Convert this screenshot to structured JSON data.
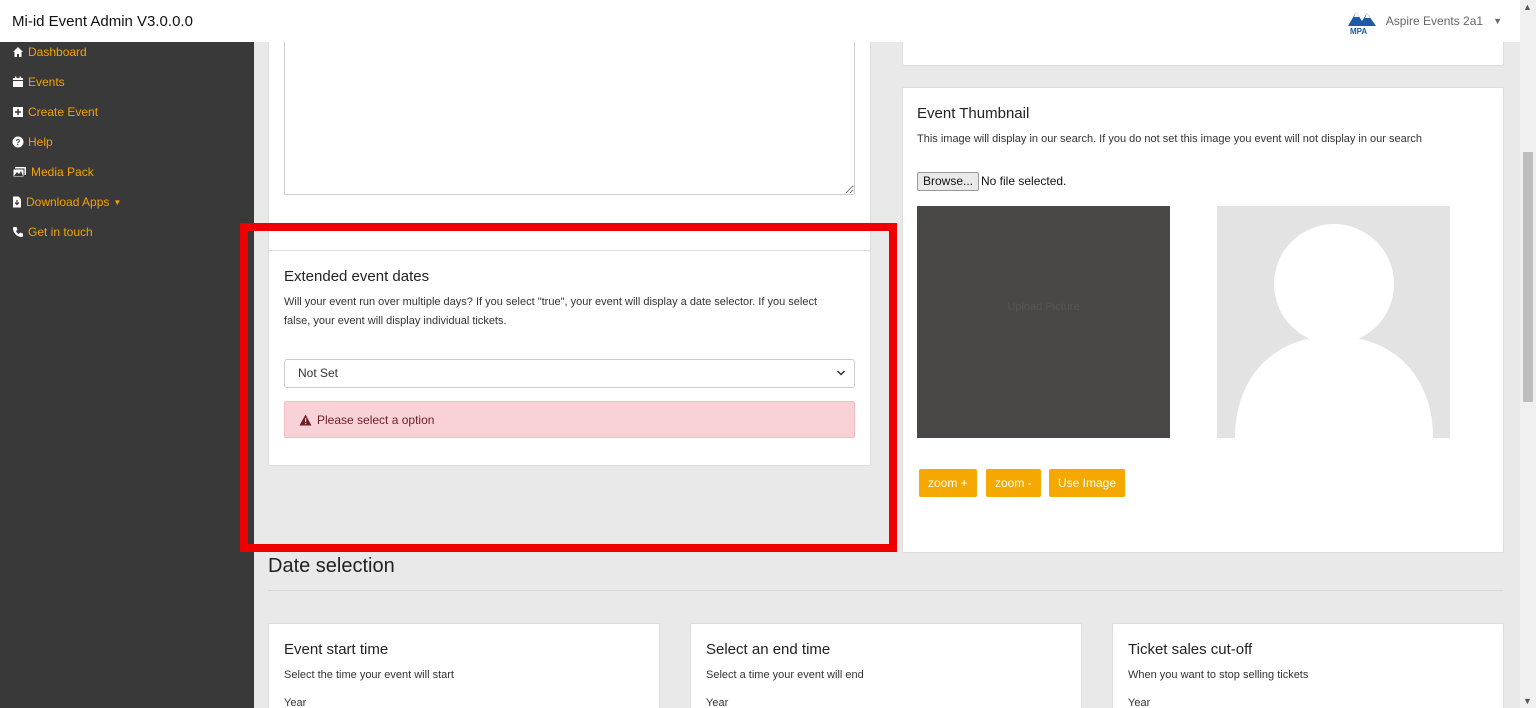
{
  "app": {
    "title": "Mi-id Event Admin V3.0.0.0",
    "user_name": "Aspire Events 2a1",
    "logo_text": "MPA"
  },
  "sidebar": {
    "items": [
      {
        "label": "Dashboard",
        "icon": "home-icon"
      },
      {
        "label": "Events",
        "icon": "calendar-icon"
      },
      {
        "label": "Create Event",
        "icon": "plus-square-icon"
      },
      {
        "label": "Help",
        "icon": "question-circle-icon"
      },
      {
        "label": "Media Pack",
        "icon": "images-icon"
      },
      {
        "label": "Download Apps",
        "icon": "file-download-icon"
      },
      {
        "label": "Get in touch",
        "icon": "phone-icon"
      }
    ]
  },
  "extended": {
    "title": "Extended event dates",
    "description": "Will your event run over multiple days? If you select \"true\", your event will display a date selector. If you select false, your event will display individual tickets.",
    "select_value": "Not Set",
    "alert": "Please select a option"
  },
  "thumbnail": {
    "title": "Event Thumbnail",
    "description": "This image will display in our search. If you do not set this image you event will not display in our search",
    "browse_label": "Browse...",
    "file_status": "No file selected.",
    "upload_label": "Upload Picture",
    "zoom_in": "zoom +",
    "zoom_out": "zoom -",
    "use_image": "Use Image"
  },
  "date_selection": {
    "title": "Date selection",
    "cards": [
      {
        "title": "Event start time",
        "description": "Select the time your event will start",
        "field_label": "Year"
      },
      {
        "title": "Select an end time",
        "description": "Select a time your event will end",
        "field_label": "Year"
      },
      {
        "title": "Ticket sales cut-off",
        "description": "When you want to stop selling tickets",
        "field_label": "Year"
      }
    ]
  },
  "colors": {
    "accent": "#f5a800",
    "sidebar_bg": "#393939",
    "highlight": "#ee0000",
    "alert_bg": "#f8d2d7"
  }
}
